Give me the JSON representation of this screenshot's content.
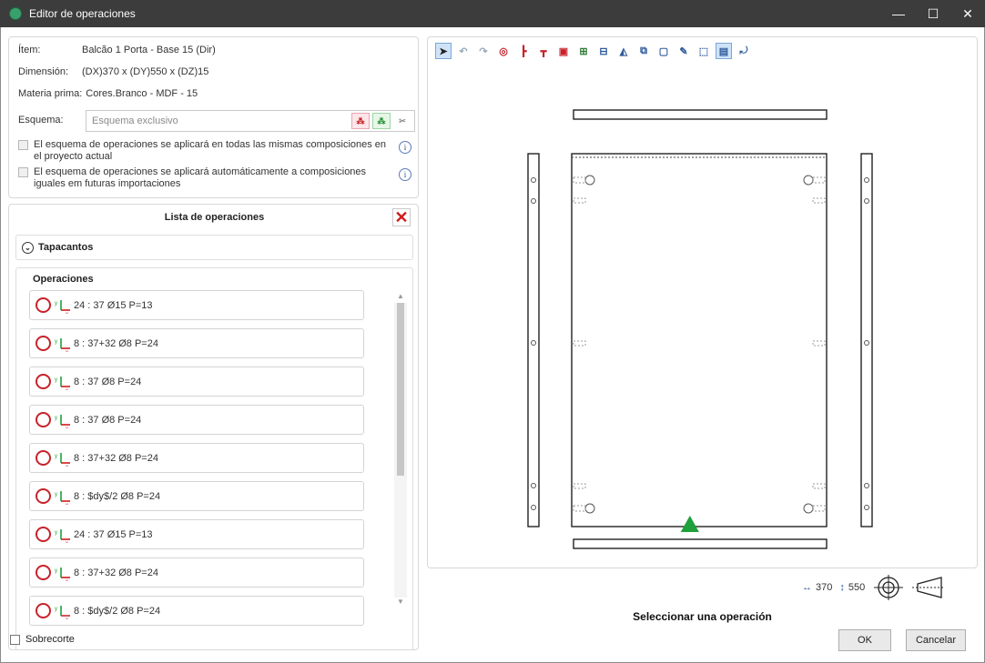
{
  "window": {
    "title": "Editor de operaciones",
    "minimize": "—",
    "maximize": "☐",
    "close": "✕"
  },
  "info": {
    "item_label": "Ítem:",
    "item_value": "Balcão 1 Porta - Base 15 (Dir)",
    "dim_label": "Dimensión:",
    "dim_value": "(DX)370 x (DY)550 x (DZ)15",
    "mat_label": "Materia prima:",
    "mat_value": "Cores.Branco - MDF - 15",
    "schema_label": "Esquema:",
    "schema_placeholder": "Esquema exclusivo",
    "check1": "El esquema de operaciones se aplicará en todas las mismas composiciones en el proyecto actual",
    "check2": "El esquema de operaciones se aplicará automáticamente a composiciones iguales em futuras importaciones"
  },
  "ops": {
    "title": "Lista de operaciones",
    "section": "Tapacantos",
    "group": "Operaciones",
    "items": [
      {
        "label": "24 : 37 Ø15 P=13",
        "icon": "axes-up-right-icon"
      },
      {
        "label": "8 : 37+32 Ø8 P=24",
        "icon": "axes-left-up-icon"
      },
      {
        "label": "8 : 37 Ø8 P=24",
        "icon": "axes-left-down-icon"
      },
      {
        "label": "8 : 37 Ø8 P=24",
        "icon": "axes-right-down-icon"
      },
      {
        "label": "8 : 37+32 Ø8 P=24",
        "icon": "axes-left-down-icon"
      },
      {
        "label": "8 : $dy$/2 Ø8 P=24",
        "icon": "axes-up-right-icon"
      },
      {
        "label": "24 : 37 Ø15 P=13",
        "icon": "axes-left-down-icon"
      },
      {
        "label": "8 : 37+32 Ø8 P=24",
        "icon": "axes-right-down-icon"
      },
      {
        "label": "8 : $dy$/2 Ø8 P=24",
        "icon": "axes-left-up-icon"
      }
    ]
  },
  "sobrecorte": "Sobrecorte",
  "status": {
    "width": "370",
    "height": "550"
  },
  "select_op": "Seleccionar una operación",
  "buttons": {
    "ok": "OK",
    "cancel": "Cancelar"
  }
}
